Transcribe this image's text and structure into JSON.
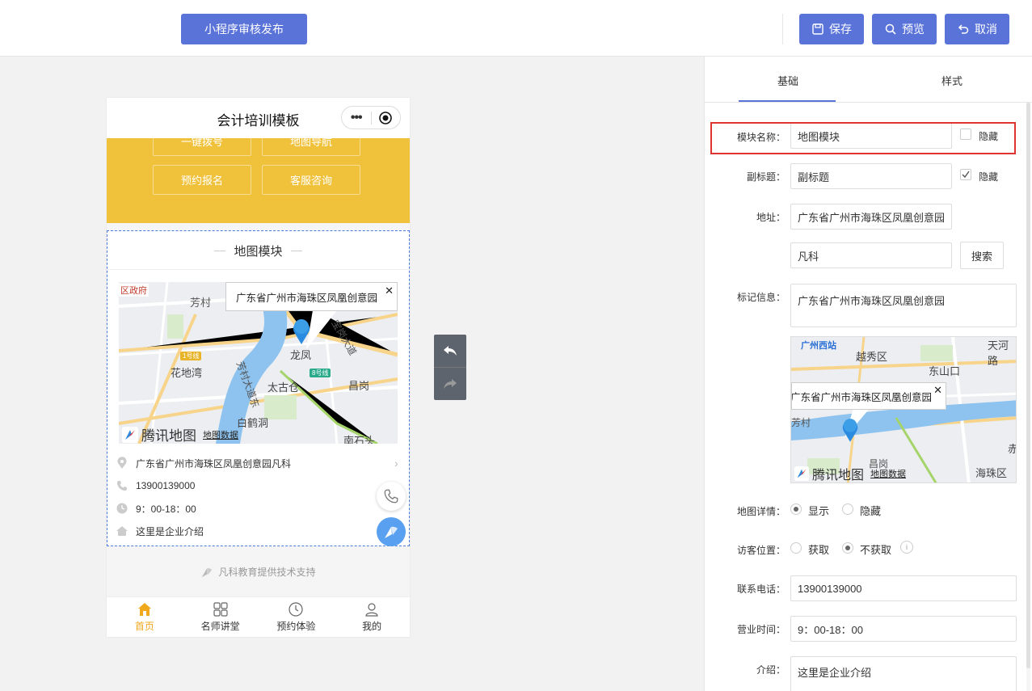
{
  "toolbar": {
    "publish_label": "小程序审核发布",
    "save_label": "保存",
    "preview_label": "预览",
    "cancel_label": "取消"
  },
  "phone": {
    "title": "会计培训模板",
    "quick_buttons": [
      "一键拨号",
      "地图导航",
      "预约报名",
      "客服咨询"
    ],
    "map_module": {
      "title": "地图模块",
      "popup": "广东省广州市海珠区凤凰创意园",
      "map_labels": [
        "区政府",
        "芳村",
        "龙凤",
        "花地湾",
        "太古仓",
        "昌岗",
        "白鹤洞",
        "南石头",
        "1号线",
        "8号线",
        "宝岗大道",
        "芳村大道东"
      ],
      "map_brand": "腾讯地图",
      "map_data_link": "地图数据",
      "address": "广东省广州市海珠区凤凰创意园凡科",
      "phone": "13900139000",
      "hours": "9：00-18：00",
      "intro": "这里是企业介绍"
    },
    "support_text": "凡科教育提供技术支持",
    "tabs": [
      "首页",
      "名师讲堂",
      "预约体验",
      "我的"
    ]
  },
  "panel": {
    "tabs": [
      "基础",
      "样式"
    ],
    "module_name_label": "模块名称：",
    "module_name_value": "地图模块",
    "hide_label": "隐藏",
    "subtitle_label": "副标题：",
    "subtitle_value": "副标题",
    "address_label": "地址：",
    "address_value": "广东省广州市海珠区凤凰创意园",
    "search_value": "凡科",
    "search_button": "搜索",
    "marker_label": "标记信息：",
    "marker_value": "广东省广州市海珠区凤凰创意园",
    "map_popup": "广东省广州市海珠区凤凰创意园",
    "map_labels": [
      "广州西站",
      "越秀区",
      "天河路",
      "东山口",
      "芳村",
      "昌岗",
      "海珠区",
      "赤"
    ],
    "map_brand": "腾讯地图",
    "map_data_link": "地图数据",
    "map_detail_label": "地图详情：",
    "map_detail_options": [
      "显示",
      "隐藏"
    ],
    "visitor_label": "访客位置：",
    "visitor_options": [
      "获取",
      "不获取"
    ],
    "info_icon": "i",
    "phone_label": "联系电话：",
    "phone_value": "13900139000",
    "hours_label": "营业时间：",
    "hours_value": "9：00-18：00",
    "intro_label": "介绍：",
    "intro_value": "这里是企业介绍"
  },
  "colors": {
    "primary": "#5a73d8",
    "yellow": "#f0c23c",
    "highlight": "#e03333",
    "tab_active": "#f0a81c"
  }
}
